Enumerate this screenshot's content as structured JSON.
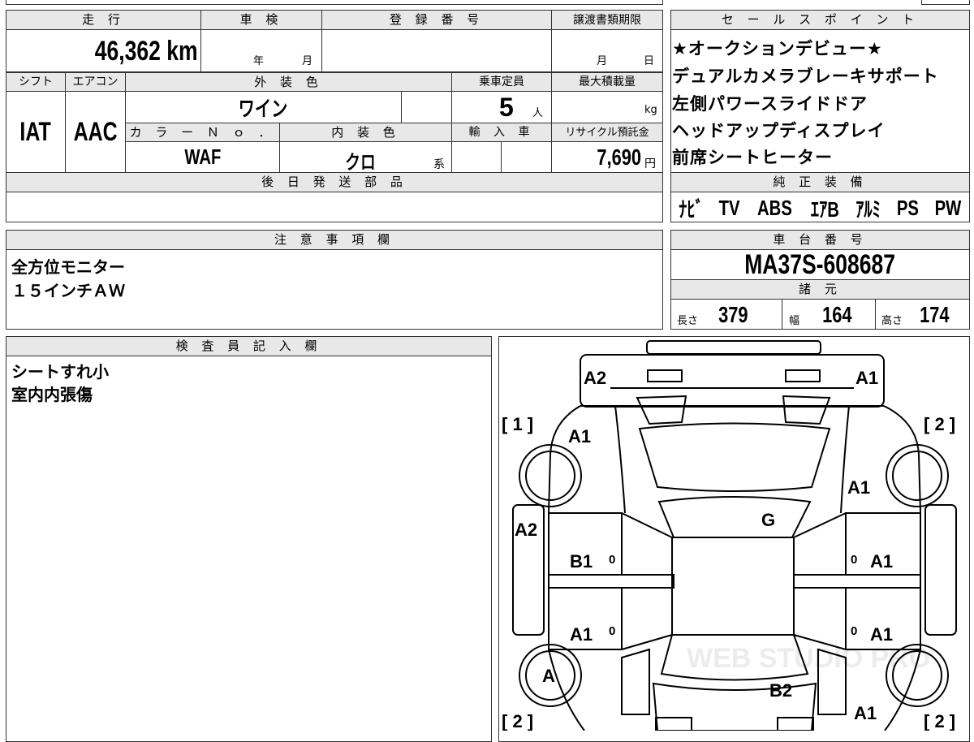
{
  "headers": {
    "mileage": "走 行",
    "inspection": "車 検",
    "registration": "登 録 番 号",
    "transfer_deadline": "譲渡書類期限",
    "sales_point": "セ ー ル ス ポ イ ン ト",
    "shift": "シフト",
    "aircon": "エアコン",
    "exterior_color": "外 装 色",
    "capacity": "乗車定員",
    "max_load": "最大積載量",
    "color_no": "カ ラ ー Ｎ ｏ ．",
    "interior_color": "内 装 色",
    "import": "輸 入 車",
    "recycle": "リサイクル預託金",
    "later_parts": "後 日 発 送 部 品",
    "genuine_equipment": "純 正 装 備",
    "notes": "注 意 事 項 欄",
    "chassis_no": "車 台 番 号",
    "specs": "諸 元",
    "inspector": "検 査 員 記 入 欄"
  },
  "values": {
    "mileage": "46,362 km",
    "year_unit": "年",
    "month_unit": "月",
    "transfer_month": "月",
    "transfer_day": "日",
    "shift": "IAT",
    "aircon": "AAC",
    "exterior_color": "ワイン",
    "capacity": "5",
    "capacity_unit": "人",
    "load_unit": "kg",
    "color_no": "WAF",
    "interior_color": "クロ",
    "interior_suffix": "系",
    "recycle": "7,690",
    "recycle_unit": "円"
  },
  "sales_points": [
    "★オークションデビュー★",
    "デュアルカメラブレーキサポート",
    "左側パワースライドドア",
    "ヘッドアップディスプレイ",
    "前席シートヒーター"
  ],
  "equipment": [
    "ﾅﾋﾞ",
    "TV",
    "ABS",
    "ｴｱB",
    "ｱﾙﾐ",
    "PS",
    "PW"
  ],
  "notes": [
    "全方位モニター",
    "１５インチＡＷ"
  ],
  "chassis_no": "MA37S-608687",
  "specs": {
    "length_label": "長さ",
    "length": "379",
    "width_label": "幅",
    "width": "164",
    "height_label": "高さ",
    "height": "174"
  },
  "inspector_notes": [
    "シートすれ小",
    "室内内張傷"
  ],
  "diagram": {
    "marks": {
      "front_left": "A2",
      "front_right": "A1",
      "fender_left": "A1",
      "fender_right": "A1",
      "pillar_left": "A2",
      "roof": "G",
      "door_front_left": "B1",
      "door_front_right": "A1",
      "door_rear_left": "A1",
      "door_rear_right": "A1",
      "wheel_rear_left": "A",
      "rear": "B2",
      "quarter_right": "A1"
    },
    "brackets": {
      "top_left": "[ 1 ]",
      "top_right": "[ 2 ]",
      "bottom_left": "[ 2 ]",
      "bottom_right": "[ 2 ]"
    },
    "window_marks": [
      "0",
      "0",
      "0",
      "0"
    ],
    "watermark": "WEB STUDIO PRO"
  }
}
